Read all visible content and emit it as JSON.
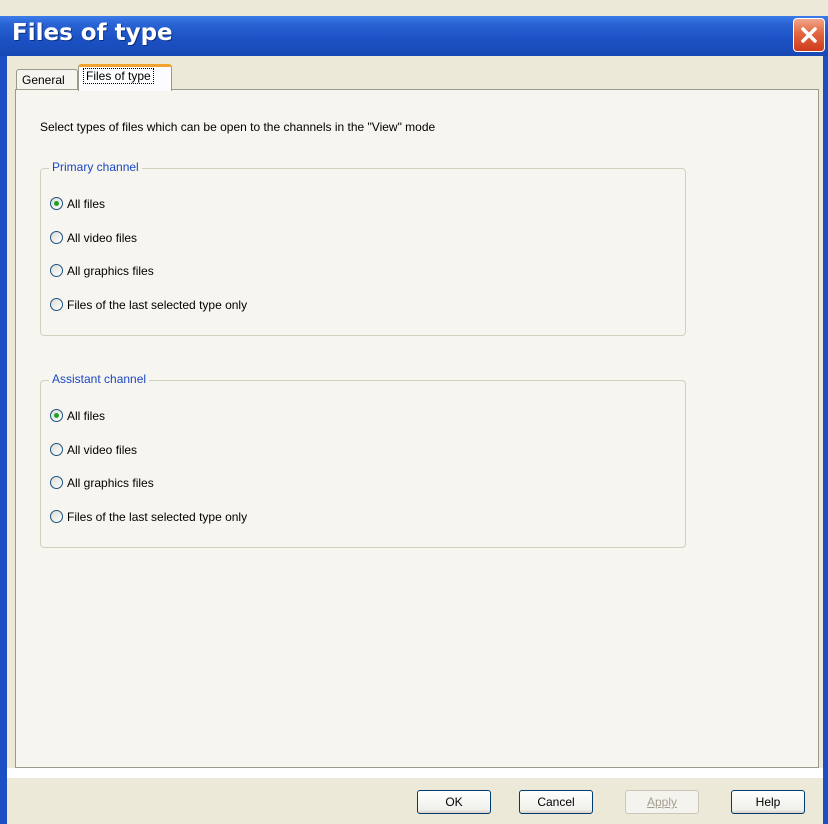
{
  "window": {
    "title": "Files of type"
  },
  "tabs": [
    {
      "label": "General",
      "active": false
    },
    {
      "label": "Files of type",
      "active": true
    }
  ],
  "panel": {
    "instruction": "Select types of files which can be open to the channels in the \"View\" mode"
  },
  "groups": {
    "primary": {
      "title": "Primary channel",
      "options": [
        {
          "label": "All files",
          "selected": true
        },
        {
          "label": "All video files",
          "selected": false
        },
        {
          "label": "All graphics files",
          "selected": false
        },
        {
          "label": "Files of the last selected type only",
          "selected": false
        }
      ]
    },
    "assistant": {
      "title": "Assistant channel",
      "options": [
        {
          "label": "All files",
          "selected": true
        },
        {
          "label": "All video files",
          "selected": false
        },
        {
          "label": "All graphics files",
          "selected": false
        },
        {
          "label": "Files of the last selected type only",
          "selected": false
        }
      ]
    }
  },
  "buttons": {
    "ok": "OK",
    "cancel": "Cancel",
    "apply": "Apply",
    "help": "Help"
  },
  "colors": {
    "titlebar": "#1c52c6",
    "close": "#e2663f",
    "radio_selected": "#21a121",
    "group_title": "#1b47c2",
    "active_tab_accent": "#f0a32f"
  }
}
